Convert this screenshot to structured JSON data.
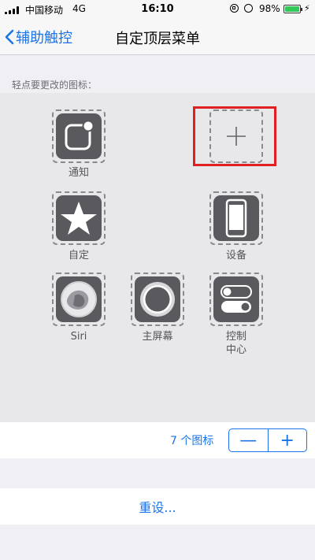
{
  "status": {
    "carrier": "中国移动",
    "network": "4G",
    "time": "16:10",
    "battery": "98%",
    "battery_level": 0.98
  },
  "nav": {
    "back_label": "辅助触控",
    "title": "自定顶层菜单"
  },
  "section_label": "轻点要更改的图标：",
  "icons": {
    "notify": "通知",
    "custom": "自定",
    "device": "设备",
    "siri": "Siri",
    "home": "主屏幕",
    "control": "控制\n中心"
  },
  "count": {
    "label": "7 个图标",
    "minus": "—",
    "plus": "+"
  },
  "reset_label": "重设..."
}
